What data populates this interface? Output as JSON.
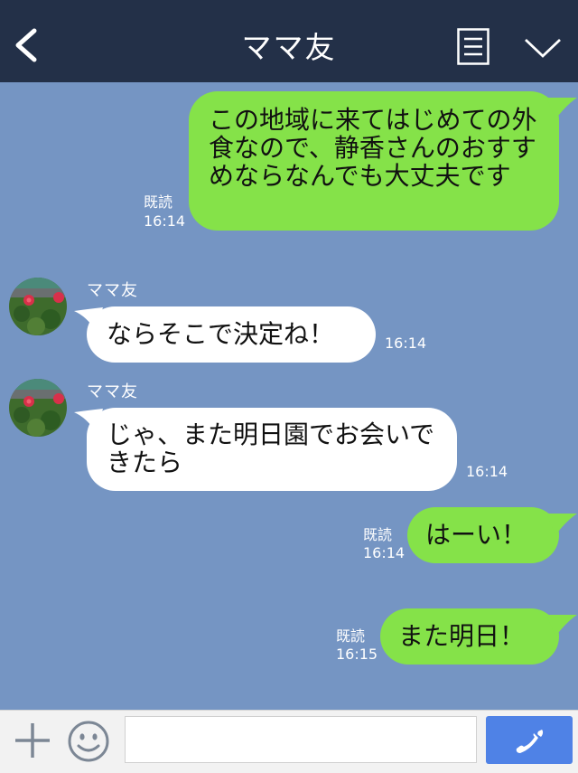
{
  "header": {
    "title": "ママ友",
    "icons": {
      "back": "chevron-left-icon",
      "menu": "menu-list-icon",
      "more": "chevron-down-icon"
    }
  },
  "messages": [
    {
      "direction": "outgoing",
      "text": "この地域に来てはじめての外食なので、静香さんのおすすめならなんでも大丈夫です",
      "read": "既読",
      "time": "16:14"
    },
    {
      "direction": "incoming",
      "sender": "ママ友",
      "text": "ならそこで決定ね！",
      "time": "16:14"
    },
    {
      "direction": "incoming",
      "sender": "ママ友",
      "text": "じゃ、また明日園でお会いできたら",
      "time": "16:14"
    },
    {
      "direction": "outgoing",
      "text": "はーい！",
      "read": "既読",
      "time": "16:14"
    },
    {
      "direction": "outgoing",
      "text": "また明日！",
      "read": "既読",
      "time": "16:15"
    }
  ],
  "footer": {
    "input_placeholder": "",
    "icons": {
      "add": "plus-icon",
      "sticker": "smile-icon",
      "call": "phone-icon"
    }
  },
  "colors": {
    "header_bg": "#233048",
    "chat_bg": "#7595c3",
    "outgoing_bubble": "#85e249",
    "incoming_bubble": "#ffffff",
    "call_button": "#4f82e6"
  }
}
